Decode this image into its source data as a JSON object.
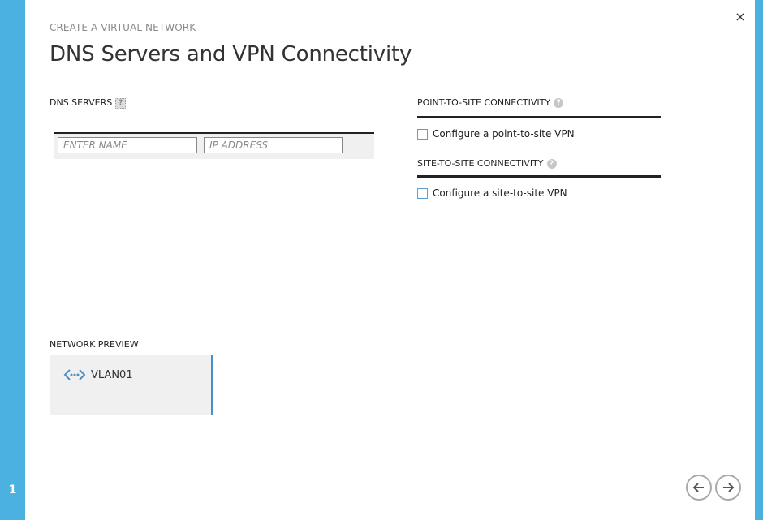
{
  "wizard": {
    "subtitle": "CREATE A VIRTUAL NETWORK",
    "title": "DNS Servers and VPN Connectivity",
    "step": "1",
    "close_glyph": "×"
  },
  "dns": {
    "label": "DNS SERVERS",
    "name_placeholder": "ENTER NAME",
    "ip_placeholder": "IP ADDRESS"
  },
  "p2s": {
    "label": "POINT-TO-SITE CONNECTIVITY",
    "checkbox_label": "Configure a point-to-site VPN"
  },
  "s2s": {
    "label": "SITE-TO-SITE CONNECTIVITY",
    "checkbox_label": "Configure a site-to-site VPN"
  },
  "preview": {
    "label": "NETWORK PREVIEW",
    "network_name": "VLAN01"
  },
  "icons": {
    "help": "?",
    "close": "close-icon",
    "back": "arrow-left-icon",
    "next": "arrow-right-icon",
    "network": "virtual-network-icon"
  },
  "colors": {
    "accent": "#4bb1e1",
    "checkbox_border": "#5a9fd1",
    "preview_accent": "#4a90c8"
  }
}
